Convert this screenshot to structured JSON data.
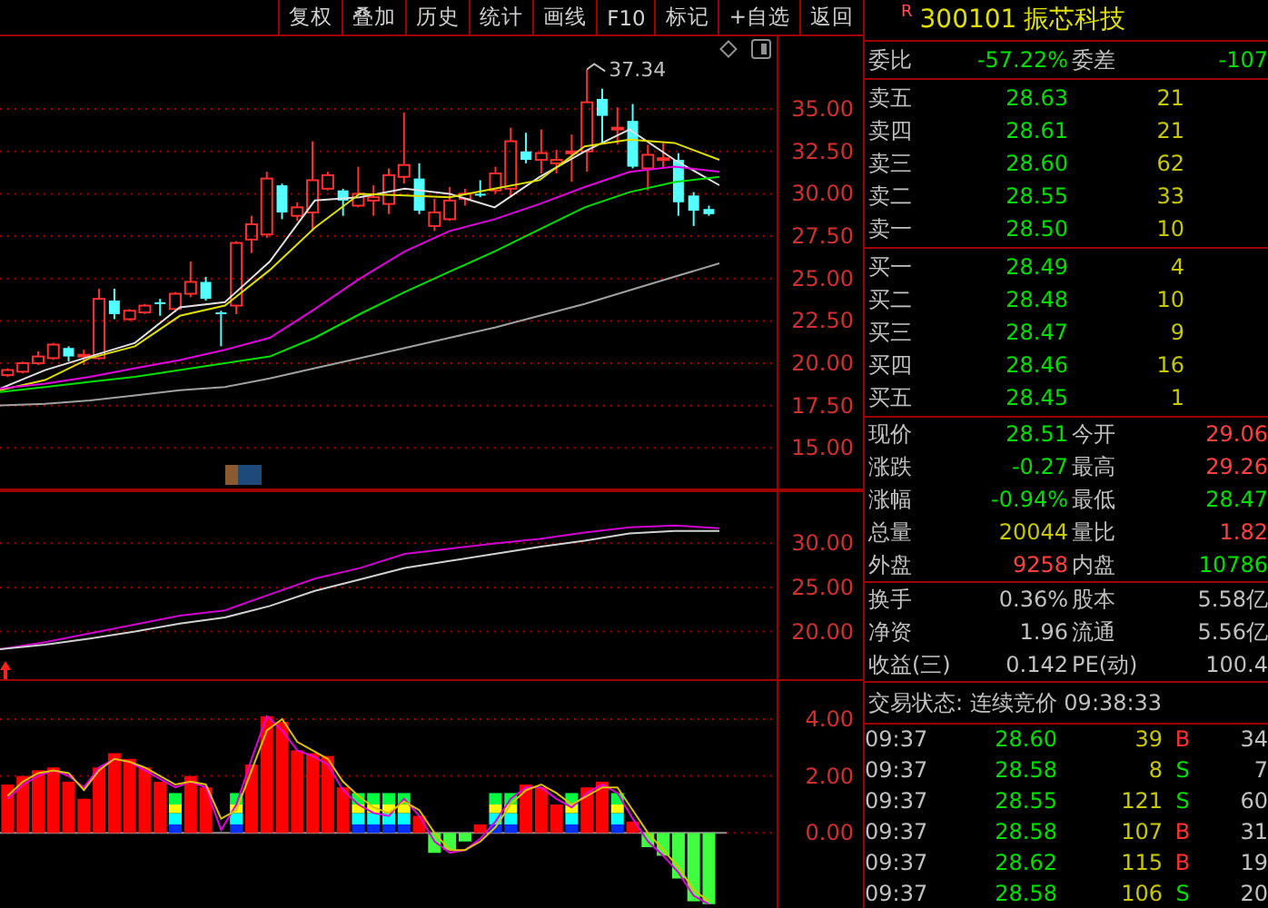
{
  "toolbar": {
    "buttons": [
      "复权",
      "叠加",
      "历史",
      "统计",
      "画线",
      "F10",
      "标记",
      "+自选",
      "返回"
    ]
  },
  "price_chart": {
    "high_label": "37.34",
    "chart_data": {
      "type": "candlestick",
      "grid": true,
      "ylim": [
        12.5,
        39.4
      ],
      "yticks": [
        {
          "value": 35,
          "label": "35.00"
        },
        {
          "value": 32.5,
          "label": "32.50"
        },
        {
          "value": 30,
          "label": "30.00"
        },
        {
          "value": 27.5,
          "label": "27.50"
        },
        {
          "value": 25,
          "label": "25.00"
        },
        {
          "value": 22.5,
          "label": "22.50"
        },
        {
          "value": 20,
          "label": "20.00"
        },
        {
          "value": 17.5,
          "label": "17.50"
        },
        {
          "value": 15,
          "label": "15.00"
        }
      ],
      "ohlc": [
        [
          19.3,
          19.7,
          19.2,
          19.6
        ],
        [
          19.5,
          20.1,
          19.4,
          20.0
        ],
        [
          20.0,
          20.7,
          19.9,
          20.4
        ],
        [
          20.3,
          21.2,
          20.2,
          21.1
        ],
        [
          20.9,
          21.0,
          20.1,
          20.4
        ],
        [
          20.5,
          20.8,
          19.9,
          20.5
        ],
        [
          20.3,
          24.4,
          20.2,
          23.8
        ],
        [
          23.7,
          24.4,
          22.6,
          22.9
        ],
        [
          22.6,
          23.2,
          22.5,
          23.1
        ],
        [
          23.0,
          23.5,
          22.9,
          23.4
        ],
        [
          23.6,
          23.8,
          22.8,
          23.5
        ],
        [
          23.2,
          24.2,
          23.0,
          24.1
        ],
        [
          24.1,
          26.0,
          23.9,
          24.8
        ],
        [
          24.8,
          25.1,
          23.7,
          23.8
        ],
        [
          23.0,
          23.1,
          21.0,
          22.9
        ],
        [
          23.4,
          27.2,
          22.9,
          27.1
        ],
        [
          27.3,
          28.7,
          26.5,
          28.2
        ],
        [
          27.6,
          31.3,
          27.4,
          30.9
        ],
        [
          30.5,
          30.6,
          28.5,
          28.9
        ],
        [
          28.7,
          29.5,
          28.4,
          29.2
        ],
        [
          28.9,
          33.1,
          27.8,
          30.8
        ],
        [
          30.3,
          31.3,
          30.2,
          31.1
        ],
        [
          30.2,
          30.3,
          28.7,
          29.6
        ],
        [
          29.3,
          31.6,
          29.2,
          30.0
        ],
        [
          29.6,
          30.5,
          28.7,
          29.8
        ],
        [
          29.4,
          31.5,
          28.8,
          31.1
        ],
        [
          31.0,
          34.8,
          30.6,
          31.7
        ],
        [
          30.9,
          31.8,
          28.8,
          29.0
        ],
        [
          28.1,
          29.7,
          27.8,
          28.9
        ],
        [
          28.5,
          30.4,
          28.4,
          29.6
        ],
        [
          29.7,
          30.3,
          29.3,
          30.0
        ],
        [
          30.0,
          30.8,
          29.8,
          29.9
        ],
        [
          30.2,
          31.6,
          30.0,
          31.2
        ],
        [
          30.3,
          33.9,
          29.8,
          33.1
        ],
        [
          32.5,
          33.6,
          31.8,
          32.0
        ],
        [
          32.0,
          33.8,
          31.2,
          32.4
        ],
        [
          31.8,
          32.6,
          31.2,
          32.0
        ],
        [
          32.4,
          33.5,
          30.7,
          32.5
        ],
        [
          32.5,
          37.34,
          31.3,
          35.4
        ],
        [
          35.6,
          36.2,
          33.0,
          34.6
        ],
        [
          33.9,
          35.1,
          32.9,
          33.9
        ],
        [
          34.3,
          35.3,
          31.5,
          31.6
        ],
        [
          31.5,
          32.9,
          30.2,
          32.3
        ],
        [
          32.1,
          33.0,
          31.5,
          32.1
        ],
        [
          32.0,
          32.4,
          28.7,
          29.5
        ],
        [
          29.9,
          30.1,
          28.1,
          29.0
        ],
        [
          29.1,
          29.3,
          28.7,
          28.8
        ],
        null,
        null,
        null,
        null
      ]
    },
    "moving_averages": {
      "chart_data": {
        "type": "line",
        "ylim": [
          12.5,
          39.4
        ],
        "series": [
          {
            "color": "#e0e0e0",
            "values": [
              18.5,
              19.6,
              20.4,
              21.2,
              23.3,
              23.6,
              26.0,
              29.6,
              29.8,
              30.3,
              30.0,
              29.2,
              31.0,
              32.5,
              33.8,
              32.0,
              30.5
            ]
          },
          {
            "color": "#e0e000",
            "values": [
              18.4,
              19.0,
              20.3,
              21.0,
              22.8,
              23.4,
              25.5,
              28.0,
              30.0,
              29.9,
              29.8,
              30.3,
              30.8,
              32.8,
              33.2,
              33.0,
              32.0
            ]
          },
          {
            "color": "#e000e0",
            "values": [
              18.5,
              18.8,
              19.2,
              19.7,
              20.2,
              20.8,
              21.5,
              23.2,
              25.0,
              26.6,
              27.8,
              28.5,
              29.4,
              30.4,
              31.3,
              31.6,
              31.3
            ]
          },
          {
            "color": "#00e000",
            "values": [
              18.3,
              18.6,
              18.9,
              19.2,
              19.6,
              20.0,
              20.4,
              21.5,
              22.9,
              24.2,
              25.4,
              26.6,
              27.9,
              29.2,
              30.1,
              30.7,
              31.0
            ]
          },
          {
            "color": "#a0a0a0",
            "values": [
              17.5,
              17.6,
              17.8,
              18.1,
              18.4,
              18.6,
              19.1,
              19.7,
              20.3,
              20.9,
              21.5,
              22.1,
              22.8,
              23.5,
              24.3,
              25.1,
              25.9
            ]
          }
        ]
      }
    }
  },
  "ma_chart": {
    "chart_data": {
      "type": "line",
      "grid": true,
      "ylim": [
        14.6,
        36.0
      ],
      "yticks": [
        {
          "value": 30,
          "label": "30.00"
        },
        {
          "value": 25,
          "label": "25.00"
        },
        {
          "value": 20,
          "label": "20.00"
        }
      ],
      "series": [
        {
          "color": "#d000d0",
          "values": [
            18.0,
            18.8,
            19.8,
            20.8,
            21.8,
            22.4,
            24.2,
            26.0,
            27.2,
            28.8,
            29.4,
            30.0,
            30.5,
            31.2,
            31.8,
            32.0,
            31.7
          ]
        },
        {
          "color": "#d0d0d0",
          "values": [
            18.0,
            18.5,
            19.2,
            20.0,
            20.9,
            21.6,
            22.9,
            24.6,
            25.9,
            27.2,
            28.0,
            28.8,
            29.6,
            30.3,
            31.1,
            31.4,
            31.4
          ]
        }
      ]
    }
  },
  "macd_chart": {
    "histogram": {
      "chart_data": {
        "type": "bar",
        "stacked": true,
        "grid": true,
        "ylim": [
          -2.7,
          5.4
        ],
        "yticks": [
          {
            "value": 4,
            "label": "4.00"
          },
          {
            "value": 2,
            "label": "2.00"
          },
          {
            "value": 0,
            "label": "0.00"
          }
        ],
        "series": [
          {
            "color": "#0030ff",
            "values": [
              0,
              0,
              0,
              0,
              0,
              0,
              0,
              0,
              0,
              0,
              0,
              0.3,
              0,
              0,
              0,
              0.3,
              0,
              0,
              0,
              0,
              0,
              0,
              0,
              0.3,
              0.3,
              0.3,
              0.3,
              0,
              0,
              0,
              0,
              0,
              0.3,
              0.3,
              0,
              0,
              0,
              0.3,
              0,
              0,
              0.3,
              0,
              0,
              0,
              0,
              0,
              0,
              null,
              null,
              null,
              null
            ]
          },
          {
            "color": "#00ffff",
            "values": [
              0,
              0,
              0,
              0,
              0,
              0,
              0,
              0,
              0,
              0,
              0,
              0.4,
              0,
              0,
              0,
              0.4,
              0,
              0,
              0,
              0,
              0,
              0,
              0,
              0.4,
              0.4,
              0.4,
              0.4,
              0,
              0,
              0,
              0,
              0,
              0.4,
              0.4,
              0,
              0,
              0,
              0.4,
              0,
              0,
              0.4,
              0,
              0,
              0,
              0,
              0,
              0,
              null,
              null,
              null,
              null
            ]
          },
          {
            "color": "#ffff00",
            "values": [
              0,
              0,
              0,
              0,
              0,
              0,
              0,
              0,
              0,
              0,
              0,
              0.3,
              0,
              0,
              0,
              0.3,
              0,
              0,
              0,
              0,
              0,
              0,
              0,
              0.3,
              0.3,
              0.3,
              0.3,
              0,
              0,
              0,
              0,
              0,
              0.3,
              0.3,
              0,
              0,
              0,
              0.3,
              0,
              0,
              0.3,
              0,
              0,
              0,
              0,
              0,
              0,
              null,
              null,
              null,
              null
            ]
          },
          {
            "color": "#00ff40",
            "values": [
              0,
              0,
              0,
              0,
              0,
              0,
              0,
              0,
              0,
              0,
              0,
              0.4,
              0,
              0,
              0,
              0.4,
              0,
              0,
              0,
              0,
              0,
              0,
              0,
              0.4,
              0.4,
              0.4,
              0.4,
              0,
              0,
              0,
              0,
              0,
              0.4,
              0.4,
              0,
              0,
              0,
              0.4,
              0,
              0,
              0.4,
              0,
              0,
              0,
              0,
              0,
              0,
              null,
              null,
              null,
              null
            ]
          },
          {
            "color": "#ff0000",
            "values": [
              1.7,
              2.0,
              2.2,
              2.3,
              1.8,
              1.2,
              2.3,
              2.8,
              2.6,
              2.3,
              1.8,
              0,
              2.0,
              1.6,
              0,
              0,
              2.4,
              4.1,
              3.9,
              2.9,
              2.8,
              2.7,
              1.6,
              0,
              0,
              0,
              0,
              0.6,
              0,
              0,
              0,
              0.3,
              0,
              0,
              1.7,
              1.6,
              1.0,
              0,
              1.6,
              1.8,
              0,
              0.4,
              0,
              0,
              0,
              0,
              0,
              null,
              null,
              null,
              null
            ]
          },
          {
            "color": "#40ff40",
            "values": [
              0,
              0,
              0,
              0,
              0,
              0,
              0,
              0,
              0,
              0,
              0,
              0,
              0,
              0,
              0,
              0,
              0,
              0,
              0,
              0,
              0,
              0,
              0,
              0,
              0,
              0,
              0,
              0,
              -0.7,
              -0.6,
              -0.3,
              0,
              0,
              0,
              0,
              0,
              0,
              0,
              0,
              0,
              0,
              0,
              -0.5,
              -0.8,
              -1.6,
              -2.4,
              -2.5,
              null,
              null,
              null,
              null
            ]
          }
        ]
      }
    },
    "signal_lines": {
      "chart_data": {
        "type": "line",
        "ylim": [
          -2.7,
          5.4
        ],
        "series": [
          {
            "color": "#e000e0",
            "values": [
              1.2,
              1.7,
              2.0,
              2.2,
              2.0,
              1.6,
              2.3,
              2.6,
              2.5,
              2.2,
              1.9,
              1.6,
              1.8,
              1.6,
              0.1,
              1.0,
              2.6,
              4.1,
              3.6,
              2.9,
              2.7,
              2.4,
              1.5,
              1.0,
              0.7,
              0.6,
              1.2,
              0.6,
              -0.3,
              -0.7,
              -0.6,
              -0.2,
              0.4,
              1.2,
              1.6,
              1.6,
              1.2,
              0.9,
              1.4,
              1.7,
              1.4,
              0.5,
              -0.3,
              -0.8,
              -1.4,
              -2.2,
              -2.5,
              null,
              null,
              null,
              null
            ]
          },
          {
            "color": "#e0c000",
            "values": [
              1.3,
              1.8,
              2.1,
              2.2,
              2.1,
              1.5,
              2.2,
              2.6,
              2.5,
              2.3,
              2.0,
              1.7,
              1.8,
              1.7,
              0.5,
              0.8,
              2.2,
              3.6,
              4.0,
              3.2,
              2.9,
              2.6,
              1.8,
              1.3,
              0.9,
              0.7,
              1.1,
              0.8,
              0,
              -0.6,
              -0.6,
              -0.3,
              0.2,
              1.0,
              1.5,
              1.7,
              1.4,
              1.0,
              1.3,
              1.6,
              1.6,
              0.8,
              0,
              -0.6,
              -1.2,
              -2.0,
              -2.4,
              null,
              null,
              null,
              null
            ]
          }
        ]
      }
    }
  },
  "quote": {
    "flag": "R",
    "code": "300101",
    "name": "振芯科技",
    "order_ratio": {
      "label": "委比",
      "value": "-57.22%",
      "diff_label": "委差",
      "diff_value": "-107"
    },
    "asks": [
      {
        "label": "卖五",
        "price": "28.63",
        "volume": "21"
      },
      {
        "label": "卖四",
        "price": "28.61",
        "volume": "21"
      },
      {
        "label": "卖三",
        "price": "28.60",
        "volume": "62"
      },
      {
        "label": "卖二",
        "price": "28.55",
        "volume": "33"
      },
      {
        "label": "卖一",
        "price": "28.50",
        "volume": "10"
      }
    ],
    "bids": [
      {
        "label": "买一",
        "price": "28.49",
        "volume": "4"
      },
      {
        "label": "买二",
        "price": "28.48",
        "volume": "10"
      },
      {
        "label": "买三",
        "price": "28.47",
        "volume": "9"
      },
      {
        "label": "买四",
        "price": "28.46",
        "volume": "16"
      },
      {
        "label": "买五",
        "price": "28.45",
        "volume": "1"
      }
    ],
    "stats": [
      {
        "label": "现价",
        "value": "28.51",
        "color": "#00e000"
      },
      {
        "label": "今开",
        "value": "29.06",
        "color": "#ff4040"
      },
      {
        "label": "涨跌",
        "value": "-0.27",
        "color": "#00e000"
      },
      {
        "label": "最高",
        "value": "29.26",
        "color": "#ff4040"
      },
      {
        "label": "涨幅",
        "value": "-0.94%",
        "color": "#00e000"
      },
      {
        "label": "最低",
        "value": "28.47",
        "color": "#00e000"
      },
      {
        "label": "总量",
        "value": "20044",
        "color": "#c8c800"
      },
      {
        "label": "量比",
        "value": "1.82",
        "color": "#ff4040"
      },
      {
        "label": "外盘",
        "value": "9258",
        "color": "#ff4040"
      },
      {
        "label": "内盘",
        "value": "10786",
        "color": "#00e000"
      }
    ],
    "fundamentals": [
      {
        "label": "换手",
        "value": "0.36%"
      },
      {
        "label": "股本",
        "value": "5.58亿"
      },
      {
        "label": "净资",
        "value": "1.96"
      },
      {
        "label": "流通",
        "value": "5.56亿"
      },
      {
        "label": "收益(三)",
        "value": "0.142"
      },
      {
        "label": "PE(动)",
        "value": "100.4"
      }
    ],
    "status": "交易状态: 连续竞价 09:38:33",
    "ticks": [
      {
        "time": "09:37",
        "price": "28.60",
        "volume": "39",
        "side": "B",
        "count": "34"
      },
      {
        "time": "09:37",
        "price": "28.58",
        "volume": "8",
        "side": "S",
        "count": "7"
      },
      {
        "time": "09:37",
        "price": "28.55",
        "volume": "121",
        "side": "S",
        "count": "60"
      },
      {
        "time": "09:37",
        "price": "28.58",
        "volume": "107",
        "side": "B",
        "count": "31"
      },
      {
        "time": "09:37",
        "price": "28.62",
        "volume": "115",
        "side": "B",
        "count": "19"
      },
      {
        "time": "09:37",
        "price": "28.58",
        "volume": "106",
        "side": "S",
        "count": "20"
      }
    ]
  }
}
